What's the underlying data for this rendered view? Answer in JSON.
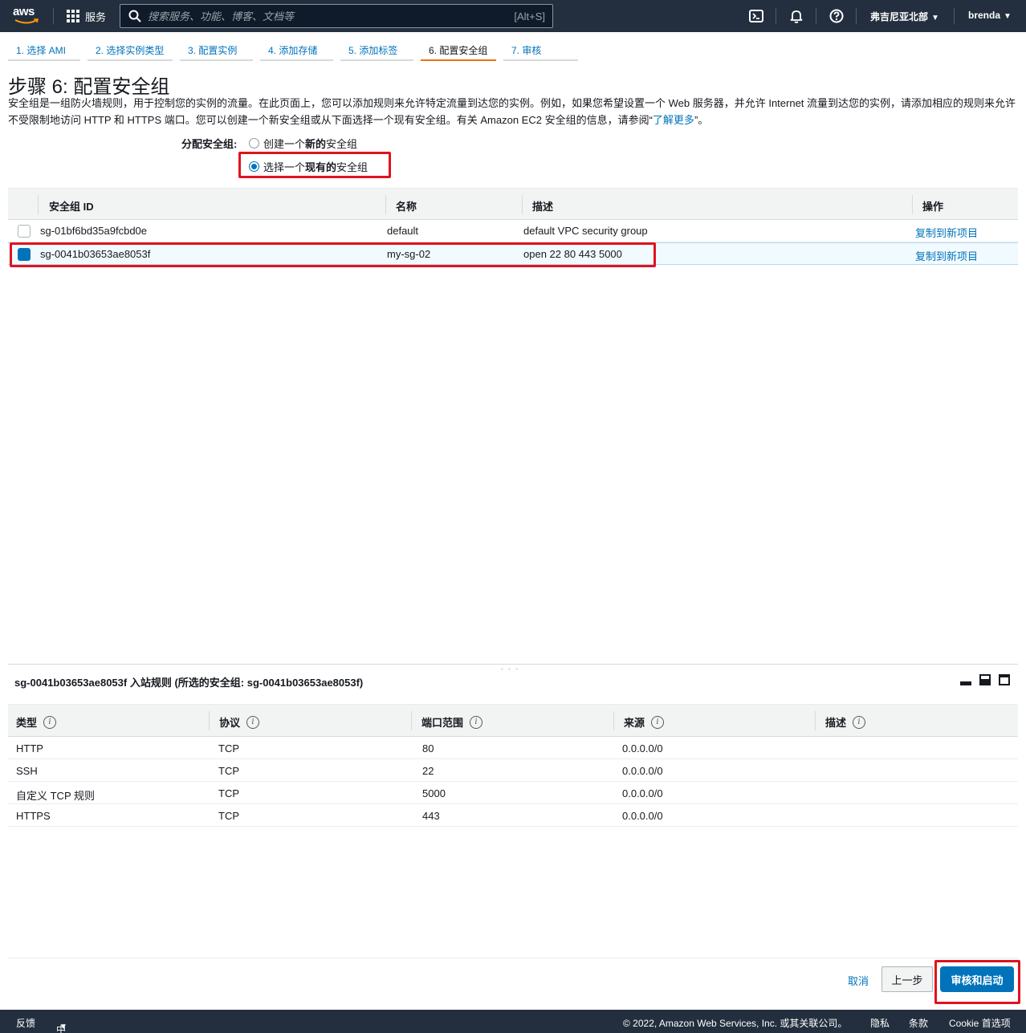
{
  "nav": {
    "logo_text": "aws",
    "services_label": "服务",
    "search_placeholder": "搜索服务、功能、博客、文档等",
    "search_hint": "[Alt+S]",
    "region": "弗吉尼亚北部",
    "user": "brenda"
  },
  "tabs": [
    {
      "label": "1. 选择 AMI"
    },
    {
      "label": "2. 选择实例类型"
    },
    {
      "label": "3. 配置实例"
    },
    {
      "label": "4. 添加存储"
    },
    {
      "label": "5. 添加标签"
    },
    {
      "label": "6. 配置安全组"
    },
    {
      "label": "7. 审核"
    }
  ],
  "page": {
    "title": "步骤 6: 配置安全组",
    "intro": "安全组是一组防火墙规则，用于控制您的实例的流量。在此页面上，您可以添加规则来允许特定流量到达您的实例。例如，如果您希望设置一个 Web 服务器，并允许 Internet 流量到达您的实例，请添加相应的规则来允许不受限制地访问 HTTP 和 HTTPS 端口。您可以创建一个新安全组或从下面选择一个现有安全组。有关 Amazon EC2 安全组的信息，请参阅“",
    "learn_more": "了解更多",
    "intro_end": "”。",
    "assign_label": "分配安全组:",
    "option_new_pre": "创建一个",
    "option_new_bold": "新的",
    "option_new_post": "安全组",
    "option_existing_pre": "选择一个",
    "option_existing_bold": "现有的",
    "option_existing_post": "安全组"
  },
  "sg_table": {
    "headers": {
      "id": "安全组 ID",
      "name": "名称",
      "desc": "描述",
      "action": "操作"
    },
    "rows": [
      {
        "id": "sg-01bf6bd35a9fcbd0e",
        "name": "default",
        "desc": "default VPC security group",
        "action": "复制到新项目",
        "selected": false
      },
      {
        "id": "sg-0041b03653ae8053f",
        "name": "my-sg-02",
        "desc": "open 22 80 443 5000",
        "action": "复制到新项目",
        "selected": true
      }
    ]
  },
  "panel": {
    "drag_handle": "◦ ◦ ◦",
    "title": "sg-0041b03653ae8053f 入站规则 (所选的安全组: sg-0041b03653ae8053f)",
    "headers": {
      "type": "类型",
      "protocol": "协议",
      "port": "端口范围",
      "source": "来源",
      "desc": "描述"
    },
    "info_glyph": "i",
    "rows": [
      {
        "type": "HTTP",
        "protocol": "TCP",
        "port": "80",
        "source": "0.0.0.0/0",
        "desc": ""
      },
      {
        "type": "SSH",
        "protocol": "TCP",
        "port": "22",
        "source": "0.0.0.0/0",
        "desc": ""
      },
      {
        "type": "自定义 TCP 规则",
        "protocol": "TCP",
        "port": "5000",
        "source": "0.0.0.0/0",
        "desc": ""
      },
      {
        "type": "HTTPS",
        "protocol": "TCP",
        "port": "443",
        "source": "0.0.0.0/0",
        "desc": ""
      }
    ]
  },
  "actions": {
    "cancel": "取消",
    "previous": "上一步",
    "review_launch": "审核和启动"
  },
  "footer": {
    "feedback": "反馈",
    "language": "中文(简体)",
    "copyright": "© 2022, Amazon Web Services, Inc. 或其关联公司。",
    "privacy": "隐私",
    "terms": "条款",
    "cookie": "Cookie 首选项"
  },
  "colors": {
    "nav_bg": "#232f3e",
    "link": "#0073bb",
    "active_tab": "#ec7211",
    "highlight_box": "#e0131f",
    "primary_button": "#0073bb"
  }
}
